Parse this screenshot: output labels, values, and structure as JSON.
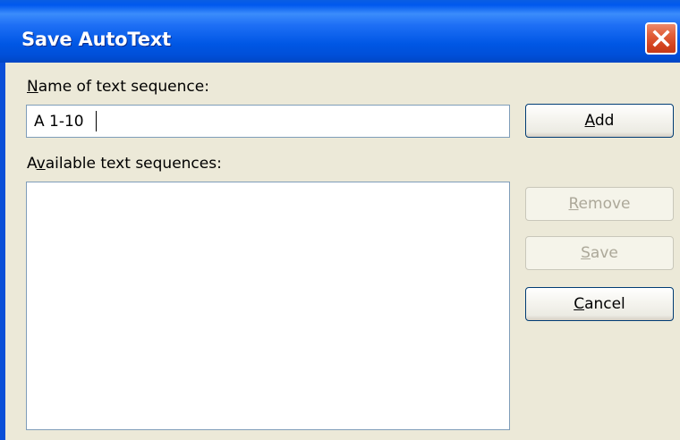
{
  "window": {
    "title": "Save AutoText",
    "close_icon": "close-icon",
    "close_color": "#d3431e",
    "titlebar_color": "#0058ee"
  },
  "name_field": {
    "label_mnemonic": "N",
    "label_rest": "ame of text sequence:",
    "value": "A 1-10"
  },
  "available": {
    "label_pre": "A",
    "label_mnemonic": "v",
    "label_rest": "ailable text sequences:",
    "items": []
  },
  "buttons": {
    "add": {
      "mnemonic": "A",
      "rest": "dd",
      "enabled": true
    },
    "remove": {
      "mnemonic": "R",
      "rest": "emove",
      "enabled": false
    },
    "save": {
      "mnemonic": "S",
      "rest": "ave",
      "enabled": false
    },
    "cancel": {
      "mnemonic": "C",
      "rest": "ancel",
      "enabled": true
    }
  }
}
